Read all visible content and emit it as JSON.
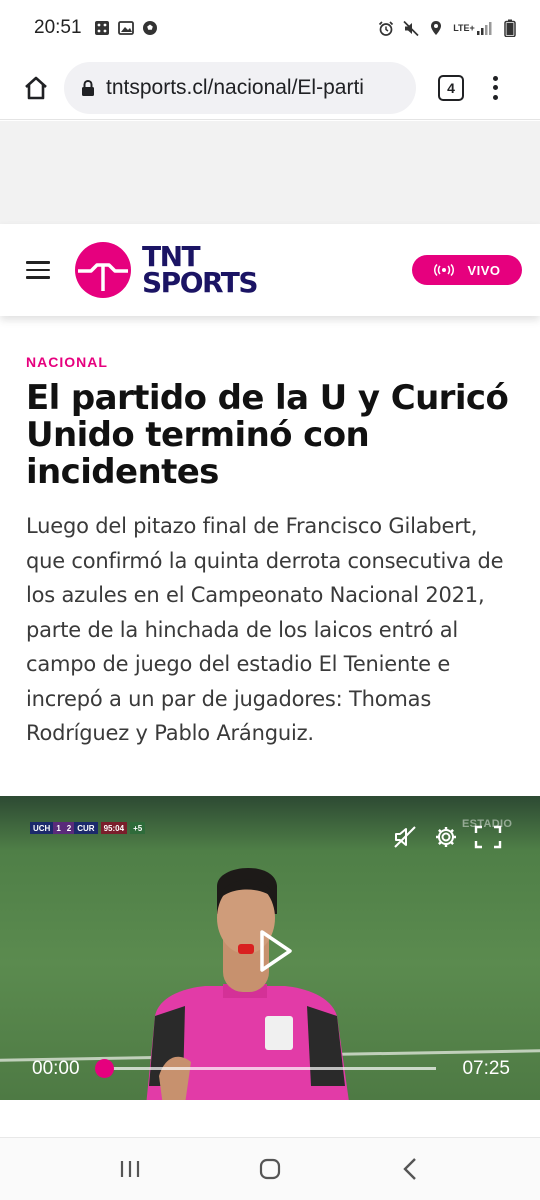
{
  "status_bar": {
    "time": "20:51",
    "left_icons": [
      "dice-icon",
      "image-icon",
      "soccer-ball-icon"
    ],
    "right_icons": [
      "alarm-icon",
      "mute-icon",
      "location-icon",
      "lte-signal-icon",
      "battery-icon"
    ],
    "network_label": "LTE+"
  },
  "browser": {
    "url": "tntsports.cl/nacional/El-parti",
    "tab_count": "4"
  },
  "site": {
    "brand_line1": "TNT",
    "brand_line2": "SPORTS",
    "live_label": "VIVO",
    "brand_color": "#e6007e"
  },
  "article": {
    "section": "NACIONAL",
    "headline": "El partido de la U y Curicó Unido terminó con incidentes",
    "lead": "Luego del pitazo final de Francisco Gilabert, que confirmó la quinta derrota consecutiva de los azules en el Campeonato Nacional 2021, parte de la hinchada de los laicos entró al campo de juego del estadio El Teniente e increpó a un par de jugadores: Thomas Rodríguez y Pablo Aránguiz."
  },
  "video": {
    "scorebug": {
      "home": "UCH",
      "home_score": "1",
      "away_score": "2",
      "away": "CUR",
      "clock": "95:04",
      "added": "+5"
    },
    "watermark": "ESTADIO",
    "current_time": "00:00",
    "duration": "07:25",
    "progress_fraction": 0.0
  }
}
